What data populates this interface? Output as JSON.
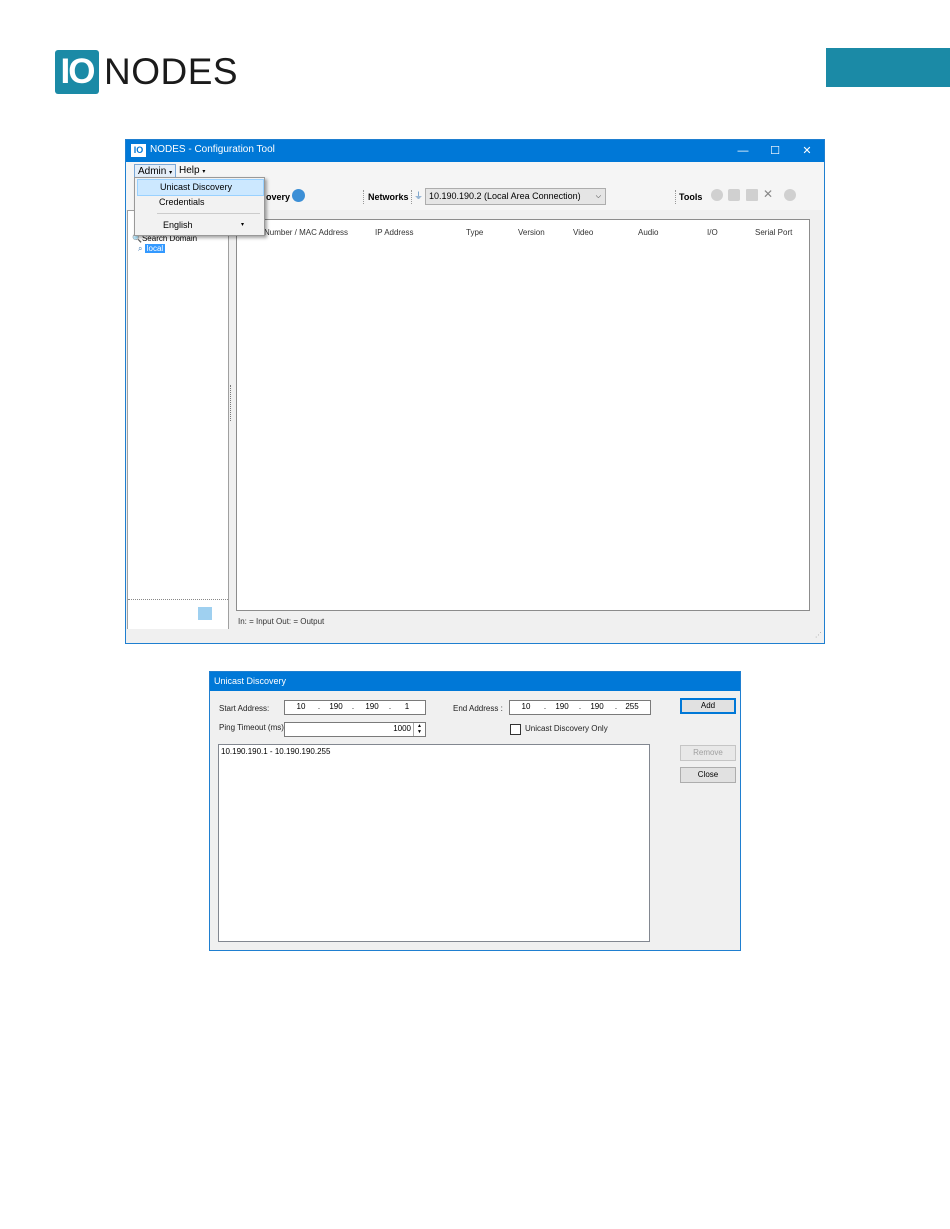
{
  "header": {
    "logo_mark": "IO",
    "logo_text": "NODES"
  },
  "window": {
    "title": "NODES - Configuration Tool",
    "icon_text": "IO",
    "controls": {
      "minimize": "—",
      "maximize": "☐",
      "close": "✕"
    }
  },
  "menu": {
    "admin": "Admin",
    "help": "Help"
  },
  "dropdown": {
    "items": [
      "Unicast Discovery",
      "Credentials",
      "English"
    ]
  },
  "toolbar": {
    "discovery_label": "overy",
    "networks_label": "Networks",
    "network_selected": "10.190.190.2 (Local Area Connection)",
    "tools_label": "Tools"
  },
  "tree": {
    "root": "Search Domain",
    "child": "local"
  },
  "grid": {
    "columns": [
      "Number / MAC Address",
      "IP Address",
      "Type",
      "Version",
      "Video",
      "Audio",
      "I/O",
      "Serial Port"
    ]
  },
  "legend": "In: = Input   Out: = Output",
  "dialog": {
    "title": "Unicast Discovery",
    "start_label": "Start Address:",
    "start": [
      "10",
      "190",
      "190",
      "1"
    ],
    "end_label": "End Address :",
    "end": [
      "10",
      "190",
      "190",
      "255"
    ],
    "ping_label": "Ping Timeout (ms):",
    "ping_value": "1000",
    "unicast_only_label": "Unicast Discovery Only",
    "unicast_only_checked": false,
    "ranges": [
      "10.190.190.1  -  10.190.190.255"
    ],
    "buttons": {
      "add": "Add",
      "remove": "Remove",
      "close": "Close"
    }
  },
  "colors": {
    "brand": "#1b8aa6",
    "titlebar": "#0078d7",
    "selection": "#3399ff"
  }
}
